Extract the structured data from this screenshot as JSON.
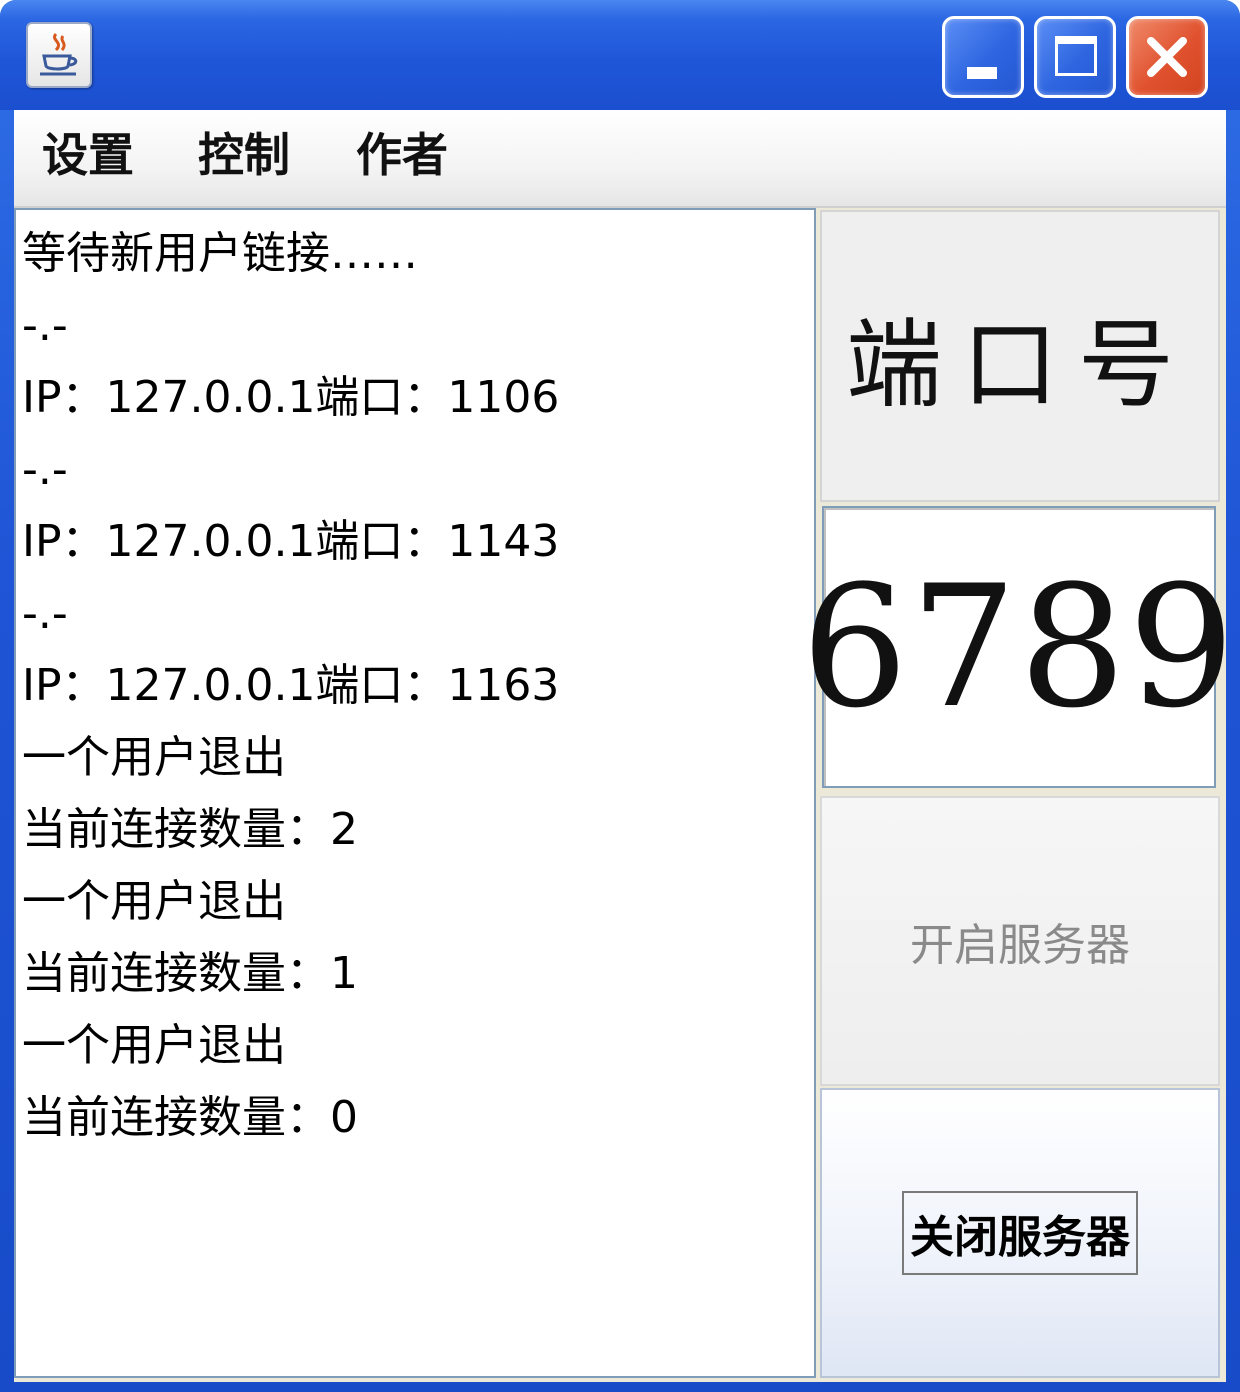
{
  "window": {
    "icon": "java-cup-icon",
    "controls": {
      "minimize_icon": "minimize-icon",
      "maximize_icon": "maximize-icon",
      "close_icon": "close-icon"
    }
  },
  "menu": {
    "items": [
      {
        "label": "设置"
      },
      {
        "label": "控制"
      },
      {
        "label": "作者"
      }
    ]
  },
  "log": {
    "lines": [
      "等待新用户链接……",
      "-.-",
      "IP：127.0.0.1端口：1106",
      "-.-",
      "IP：127.0.0.1端口：1143",
      "-.-",
      "IP：127.0.0.1端口：1163",
      "一个用户退出",
      "当前连接数量：2",
      "一个用户退出",
      "当前连接数量：1",
      "一个用户退出",
      "当前连接数量：0"
    ]
  },
  "panel": {
    "port_label": "端口号",
    "port_value": "6789",
    "start_button": "开启服务器",
    "stop_button": "关闭服务器"
  },
  "colors": {
    "titlebar": "#2b66e3",
    "close_button": "#e0522f",
    "log_border": "#7f9db9",
    "start_button_text_disabled": "#8a8a8a"
  }
}
